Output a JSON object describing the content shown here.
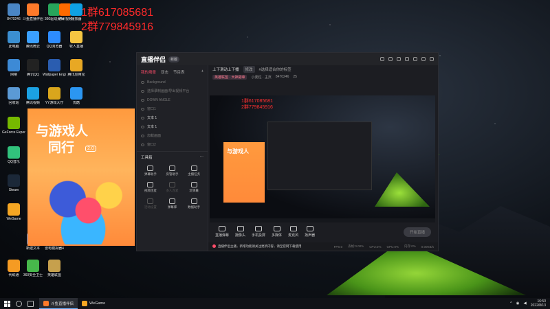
{
  "qq_groups": [
    "1群617085681",
    "2群779845916"
  ],
  "desktop_icons": [
    {
      "label": "8470246",
      "color": "#4a86c5"
    },
    {
      "label": "斗鱼直播伴侣",
      "color": "#ff7a2a"
    },
    {
      "label": "360驱动大师",
      "color": "#27a65b"
    },
    {
      "label": "腾讯视频",
      "color": "#ff6a00"
    },
    {
      "label": "播放器",
      "color": "#0fa1e3"
    },
    {
      "label": "此电脑",
      "color": "#3b8fd1"
    },
    {
      "label": "腾讯微云",
      "color": "#3aa0ff"
    },
    {
      "label": "QQ浏览器",
      "color": "#2d8cff"
    },
    {
      "label": "牧人直播",
      "color": "#f6c642"
    },
    {
      "label": "网络",
      "color": "#3d8ad6"
    },
    {
      "label": "腾讯QQ",
      "color": "#222"
    },
    {
      "label": "Wallpaper Engine",
      "color": "#2a5db0"
    },
    {
      "label": "腾讯应用宝",
      "color": "#e8a824"
    },
    {
      "label": "回收站",
      "color": "#5b9ad5"
    },
    {
      "label": "腾讯视频",
      "color": "#1ba1e2"
    },
    {
      "label": "YY游戏大厅",
      "color": "#d9a61c"
    },
    {
      "label": "优酷",
      "color": "#2b96f2"
    },
    {
      "label": "GeForce Experience",
      "color": "#76b900"
    },
    {
      "label": "QQ音乐",
      "color": "#31c27c"
    },
    {
      "label": "Steam",
      "color": "#1b2838"
    },
    {
      "label": "WeGame",
      "color": "#f5a623"
    },
    {
      "label": "新建文本",
      "color": "#3c7fd6"
    },
    {
      "label": "雷电模拟器4",
      "color": "#1e88e5"
    },
    {
      "label": "代练通",
      "color": "#f59b23"
    },
    {
      "label": "360安全卫士",
      "color": "#47b84b"
    },
    {
      "label": "英雄联盟",
      "color": "#c6a04d"
    }
  ],
  "poster": {
    "line1": "与游戏人",
    "line2": "同行",
    "version": "2.0"
  },
  "app": {
    "title": "直播伴侣",
    "badge": "新版",
    "left_tabs": [
      {
        "label": "我的场景",
        "active": true
      },
      {
        "label": "双击"
      },
      {
        "label": "节目表"
      }
    ],
    "add": "+",
    "sources": [
      {
        "label": "Background",
        "lit": false
      },
      {
        "label": "选择录制画面/导出视频平台",
        "lit": false
      },
      {
        "label": "DOWN ANGLE",
        "lit": false
      },
      {
        "label": "窗口1",
        "lit": false
      },
      {
        "label": "文本 1",
        "lit": true
      },
      {
        "label": "文本 1",
        "lit": true
      },
      {
        "label": "加载画面",
        "lit": false
      },
      {
        "label": "窗口2",
        "lit": false
      }
    ],
    "tools_header": "工具箱",
    "tools_more": "···",
    "tools": [
      {
        "label": "弹幕助手",
        "dim": false
      },
      {
        "label": "房管助手",
        "dim": false
      },
      {
        "label": "主播任务",
        "dim": false
      },
      {
        "label": "视频连麦",
        "dim": false
      },
      {
        "label": "多人连麦",
        "dim": true
      },
      {
        "label": "玩弹幕",
        "dim": false
      },
      {
        "label": "活动设置",
        "dim": true
      },
      {
        "label": "弹幕库",
        "dim": false
      },
      {
        "label": "数据助手",
        "dim": false
      }
    ],
    "stream_title": "上下滑动上下播",
    "stream_edit": "修改",
    "stream_tag": "#选择适合你的标签",
    "stream_sub": [
      "英雄联盟 · 大神巅峰",
      "小麦粒 · 主页",
      "8470246"
    ],
    "views": "25",
    "controls": [
      "直播弹幕",
      "摄像头",
      "手机投屏",
      "多媒体",
      "麦克风",
      "扬声器"
    ],
    "go_live": "开始直播",
    "status": {
      "notice": "直播伴侣主播，新增功能请关注更新内容，请至官网下载使用",
      "items": [
        "FPS:0",
        "丢帧:0.00%",
        "CPU:2%",
        "GPU:0%",
        "内存:0%",
        "0.00KB/s"
      ]
    },
    "preview_groups": [
      "1群617085681",
      "2群779845916"
    ]
  },
  "taskbar": {
    "apps": [
      {
        "label": "斗鱼直播伴侣",
        "active": true,
        "color": "#ff7a2a"
      },
      {
        "label": "WeGame",
        "active": false,
        "color": "#f5a623"
      }
    ],
    "time": "16:50",
    "date": "2022/8/13"
  }
}
